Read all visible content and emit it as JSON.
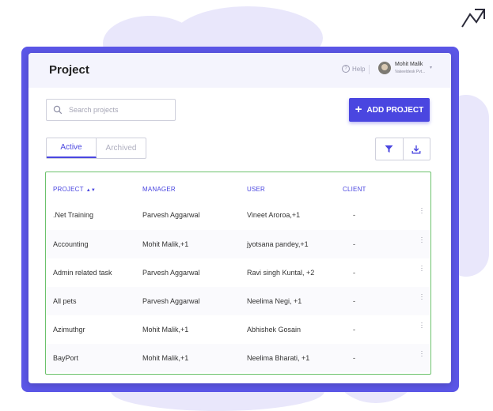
{
  "header": {
    "title": "Project",
    "help_label": "Help",
    "user": {
      "name": "Mohit Malik",
      "org": "Vakeeldesk Pvt..."
    }
  },
  "toolbar": {
    "search_placeholder": "Search projects",
    "add_label": "ADD PROJECT"
  },
  "tabs": [
    {
      "label": "Active",
      "selected": true
    },
    {
      "label": "Archived",
      "selected": false
    }
  ],
  "table": {
    "columns": [
      "PROJECT",
      "MANAGER",
      "USER",
      "CLIENT"
    ],
    "rows": [
      {
        "project": ".Net Training",
        "manager": "Parvesh Aggarwal",
        "user": "Vineet Aroroa,+1",
        "client": "-"
      },
      {
        "project": "Accounting",
        "manager": "Mohit Malik,+1",
        "user": "jyotsana pandey,+1",
        "client": "-"
      },
      {
        "project": "Admin related task",
        "manager": "Parvesh Aggarwal",
        "user": "Ravi singh Kuntal, +2",
        "client": "-"
      },
      {
        "project": "All pets",
        "manager": "Parvesh Aggarwal",
        "user": "Neelima Negi, +1",
        "client": "-"
      },
      {
        "project": "Azimuthgr",
        "manager": "Mohit Malik,+1",
        "user": "Abhishek Gosain",
        "client": "-"
      },
      {
        "project": "BayPort",
        "manager": "Mohit Malik,+1",
        "user": "Neelima Bharati, +1",
        "client": "-"
      }
    ]
  },
  "colors": {
    "accent": "#4a46e0",
    "frame": "#5b56e6",
    "table_border": "#6cc26c",
    "header_bg": "#f4f4fd"
  },
  "icons": [
    "search-icon",
    "plus-icon",
    "filter-icon",
    "download-icon",
    "help-icon",
    "more-vertical-icon",
    "sort-icon",
    "chevron-down-icon"
  ]
}
